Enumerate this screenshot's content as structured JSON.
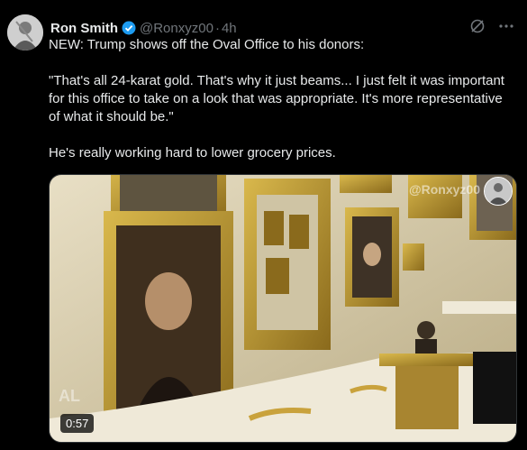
{
  "author": {
    "name": "Ron Smith",
    "handle": "@Ronxyz00",
    "separator": "·",
    "time": "4h"
  },
  "icons": {
    "verified": "verified-badge-icon",
    "grok": "grok-icon",
    "more": "more-options-icon"
  },
  "colors": {
    "background": "#000000",
    "text": "#e7e9ea",
    "secondary": "#71767b",
    "verified": "#1d9bf0"
  },
  "tweet": {
    "line1": "NEW: Trump shows off the Oval Office to his donors:",
    "quote": "\"That's all 24-karat gold. That's why it just beams... I just felt it was important for this office to take on a look that was appropriate. It's more representative of what it should be.\"",
    "comment": "He's really working hard to lower grocery prices."
  },
  "media": {
    "watermark": "@Ronxyz00",
    "logo": "AL",
    "duration": "0:57"
  }
}
